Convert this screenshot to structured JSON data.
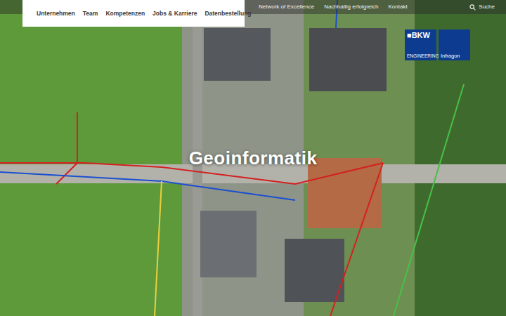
{
  "main_nav": [
    {
      "label": "Unternehmen"
    },
    {
      "label": "Team"
    },
    {
      "label": "Kompetenzen"
    },
    {
      "label": "Jobs & Karriere"
    },
    {
      "label": "Datenbestellung"
    }
  ],
  "top_links": [
    {
      "label": "Network of Excellence"
    },
    {
      "label": "Nachhaltig erfolgreich"
    },
    {
      "label": "Kontakt"
    }
  ],
  "search": {
    "label": "Suche"
  },
  "logo": {
    "brand": "■BKW",
    "division": "ENGINEERING",
    "company": "Infragon"
  },
  "hero": {
    "title": "Geoinformatik"
  }
}
